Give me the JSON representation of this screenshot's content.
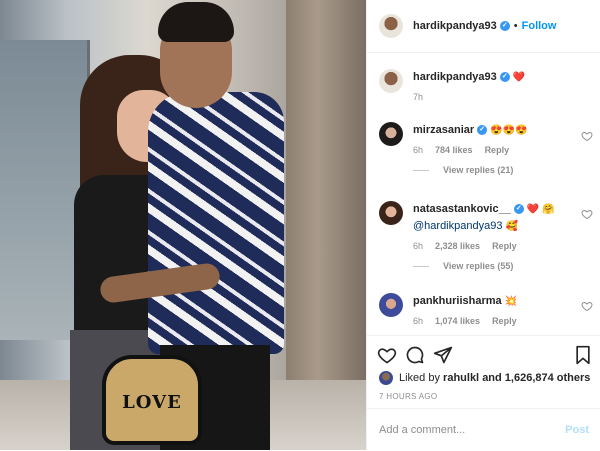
{
  "header": {
    "username": "hardikpandya93",
    "separator": "•",
    "follow_label": "Follow"
  },
  "caption": {
    "username": "hardikpandya93",
    "emoji": "❤️",
    "time": "7h"
  },
  "comments": [
    {
      "username": "mirzasaniar",
      "emoji": "😍😍😍",
      "time": "6h",
      "likes": "784 likes",
      "reply_label": "Reply",
      "view_replies": "View replies (21)"
    },
    {
      "username": "natasastankovic__",
      "emoji": "❤️ 🤗",
      "mention": "@hardikpandya93",
      "mention_emoji": "🥰",
      "time": "6h",
      "likes": "2,328 likes",
      "reply_label": "Reply",
      "view_replies": "View replies (55)"
    },
    {
      "username": "pankhuriisharma",
      "emoji": "💥",
      "time": "6h",
      "likes": "1,074 likes",
      "reply_label": "Reply"
    }
  ],
  "likes": {
    "prefix": "Liked by",
    "user": "rahulkl",
    "suffix": "and 1,626,874 others"
  },
  "timestamp": "7 HOURS AGO",
  "add_comment": {
    "placeholder": "Add a comment...",
    "post_label": "Post"
  },
  "photo": {
    "bag_text": "LOVE"
  },
  "colors": {
    "accent": "#0095f6",
    "verified": "#3897f0",
    "muted": "#8e8e8e",
    "like_red": "#ed4956"
  },
  "icons": [
    "heart-icon",
    "comment-icon",
    "share-icon",
    "bookmark-icon",
    "verified-icon"
  ]
}
